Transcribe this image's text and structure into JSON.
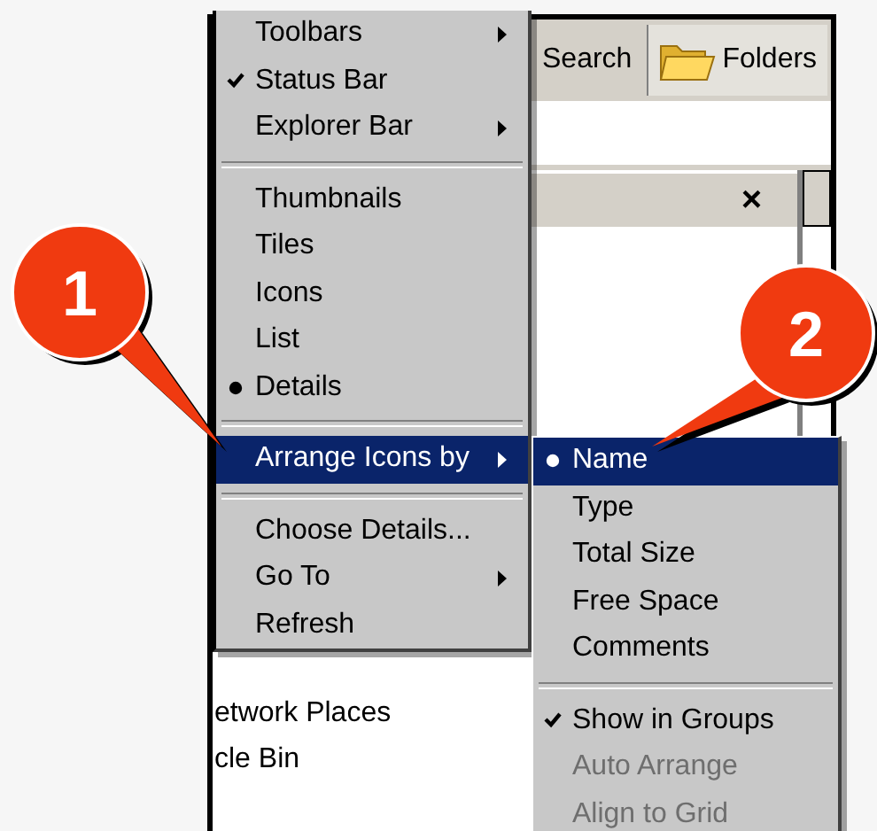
{
  "toolbar": {
    "buttons": [
      {
        "label": "Search",
        "kind": "text"
      },
      {
        "label": "Folders",
        "kind": "folder"
      }
    ]
  },
  "folders_pane": {
    "close": "×",
    "items": [
      "etwork Places",
      "cle Bin"
    ]
  },
  "view_menu": {
    "items": [
      {
        "kind": "item",
        "label": "Toolbars",
        "checked": false,
        "bullet": false,
        "submenu": true,
        "selected": false,
        "disabled": false
      },
      {
        "kind": "item",
        "label": "Status Bar",
        "checked": true,
        "bullet": false,
        "submenu": false,
        "selected": false,
        "disabled": false
      },
      {
        "kind": "item",
        "label": "Explorer Bar",
        "checked": false,
        "bullet": false,
        "submenu": true,
        "selected": false,
        "disabled": false
      },
      {
        "kind": "separator"
      },
      {
        "kind": "item",
        "label": "Thumbnails",
        "checked": false,
        "bullet": false,
        "submenu": false,
        "selected": false,
        "disabled": false
      },
      {
        "kind": "item",
        "label": "Tiles",
        "checked": false,
        "bullet": false,
        "submenu": false,
        "selected": false,
        "disabled": false
      },
      {
        "kind": "item",
        "label": "Icons",
        "checked": false,
        "bullet": false,
        "submenu": false,
        "selected": false,
        "disabled": false
      },
      {
        "kind": "item",
        "label": "List",
        "checked": false,
        "bullet": false,
        "submenu": false,
        "selected": false,
        "disabled": false
      },
      {
        "kind": "item",
        "label": "Details",
        "checked": false,
        "bullet": true,
        "submenu": false,
        "selected": false,
        "disabled": false
      },
      {
        "kind": "separator"
      },
      {
        "kind": "item",
        "label": "Arrange Icons by",
        "checked": false,
        "bullet": false,
        "submenu": true,
        "selected": true,
        "disabled": false
      },
      {
        "kind": "separator"
      },
      {
        "kind": "item",
        "label": "Choose Details...",
        "checked": false,
        "bullet": false,
        "submenu": false,
        "selected": false,
        "disabled": false
      },
      {
        "kind": "item",
        "label": "Go To",
        "checked": false,
        "bullet": false,
        "submenu": true,
        "selected": false,
        "disabled": false
      },
      {
        "kind": "item",
        "label": "Refresh",
        "checked": false,
        "bullet": false,
        "submenu": false,
        "selected": false,
        "disabled": false
      }
    ]
  },
  "arrange_submenu": {
    "items": [
      {
        "kind": "item",
        "label": "Name",
        "checked": false,
        "bullet": true,
        "submenu": false,
        "selected": true,
        "disabled": false
      },
      {
        "kind": "item",
        "label": "Type",
        "checked": false,
        "bullet": false,
        "submenu": false,
        "selected": false,
        "disabled": false
      },
      {
        "kind": "item",
        "label": "Total Size",
        "checked": false,
        "bullet": false,
        "submenu": false,
        "selected": false,
        "disabled": false
      },
      {
        "kind": "item",
        "label": "Free Space",
        "checked": false,
        "bullet": false,
        "submenu": false,
        "selected": false,
        "disabled": false
      },
      {
        "kind": "item",
        "label": "Comments",
        "checked": false,
        "bullet": false,
        "submenu": false,
        "selected": false,
        "disabled": false
      },
      {
        "kind": "separator"
      },
      {
        "kind": "item",
        "label": "Show in Groups",
        "checked": true,
        "bullet": false,
        "submenu": false,
        "selected": false,
        "disabled": false
      },
      {
        "kind": "item",
        "label": "Auto Arrange",
        "checked": false,
        "bullet": false,
        "submenu": false,
        "selected": false,
        "disabled": true
      },
      {
        "kind": "item",
        "label": "Align to Grid",
        "checked": false,
        "bullet": false,
        "submenu": false,
        "selected": false,
        "disabled": true
      }
    ]
  },
  "callouts": [
    {
      "number": "1"
    },
    {
      "number": "2"
    }
  ]
}
